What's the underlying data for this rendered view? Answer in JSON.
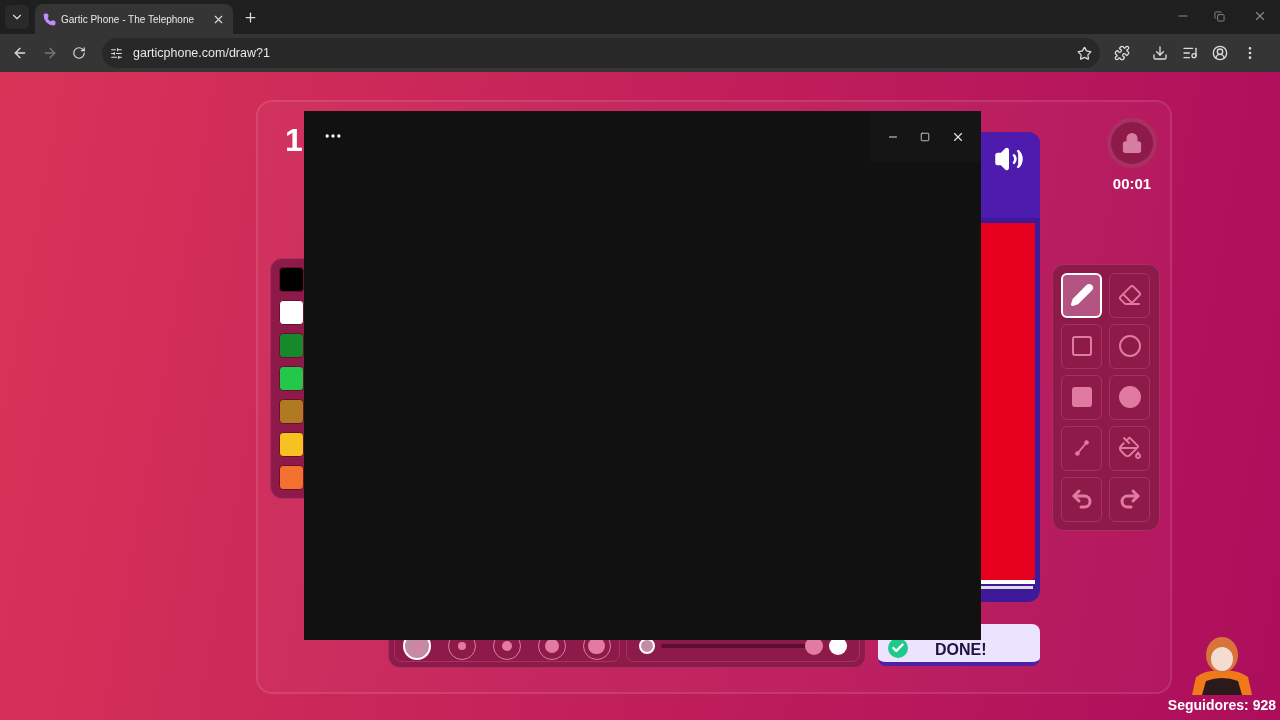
{
  "browser": {
    "tab": {
      "title": "Gartic Phone - The Telephone"
    },
    "url": "garticphone.com/draw?1"
  },
  "game": {
    "round": "1",
    "colors": [
      {
        "color": "#000000"
      },
      {
        "color": "#ffffff"
      },
      {
        "color": "#168a2a"
      },
      {
        "color": "#23c84a"
      },
      {
        "color": "#b07a22"
      },
      {
        "color": "#f5c21f"
      },
      {
        "color": "#f2712e"
      }
    ],
    "canvas": {
      "color": "#e8001f"
    },
    "timer": "00:01",
    "tools": [
      {
        "kind": "pencil",
        "selected": true
      },
      {
        "kind": "eraser",
        "selected": false
      },
      {
        "kind": "rectangle",
        "selected": false
      },
      {
        "kind": "ellipse",
        "selected": false
      },
      {
        "kind": "filled_rectangle",
        "selected": false
      },
      {
        "kind": "filled_ellipse",
        "selected": false
      },
      {
        "kind": "line",
        "selected": false
      },
      {
        "kind": "bucket",
        "selected": false
      },
      {
        "kind": "undo",
        "selected": false
      },
      {
        "kind": "redo",
        "selected": false
      }
    ],
    "sizes": [
      {
        "selected": true
      },
      {
        "selected": false
      },
      {
        "selected": false
      },
      {
        "selected": false
      },
      {
        "selected": false
      }
    ],
    "opacity": {
      "level": 1
    },
    "done_button": "DONE!"
  },
  "stream": {
    "followers": "Seguidores: 928"
  }
}
